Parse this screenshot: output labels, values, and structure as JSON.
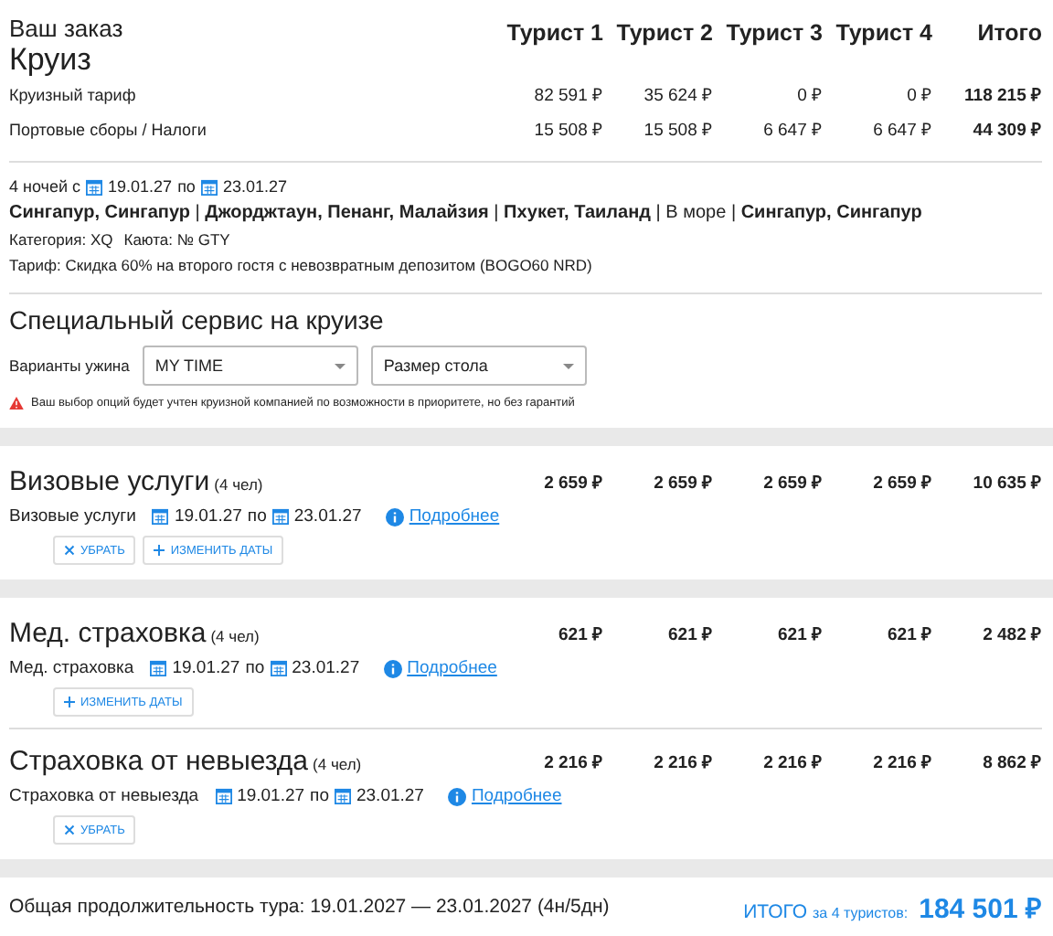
{
  "order": {
    "title": "Ваш заказ",
    "subtitle": "Круиз",
    "columns": [
      "Турист 1",
      "Турист 2",
      "Турист 3",
      "Турист 4",
      "Итого"
    ],
    "rows": [
      {
        "label": "Круизный тариф",
        "values": [
          "82 591 ₽",
          "35 624 ₽",
          "0 ₽",
          "0 ₽",
          "118 215 ₽"
        ]
      },
      {
        "label": "Портовые сборы / Налоги",
        "values": [
          "15 508 ₽",
          "15 508 ₽",
          "6 647 ₽",
          "6 647 ₽",
          "44 309 ₽"
        ]
      }
    ]
  },
  "cruise": {
    "nights": "4 ночей с",
    "from": "19.01.27",
    "by": "по",
    "to": "23.01.27",
    "route": "**Сингапур, Сингапур** | **Джорджтаун, Пенанг, Малайзия** | **Пхукет, Таиланд** | В море | **Сингапур, Сингапур**",
    "category": "Категория: XQ",
    "cabin": "Каюта: № GTY",
    "tariff": "Тариф: Скидка 60% на второго гостя с невозвратным депозитом (BOGO60 NRD)"
  },
  "special": {
    "title": "Специальный сервис на круизе",
    "label": "Варианты ужина",
    "selects": [
      {
        "value": "MY TIME"
      },
      {
        "placeholder": "Размер стола"
      }
    ],
    "warning": "Ваш выбор опций будет учтен круизной компанией по возможности в приоритете, но без гарантий"
  },
  "service_groups": [
    [
      {
        "title": "Визовые услуги",
        "persons": "(4 чел)",
        "prices": [
          "2 659 ₽",
          "2 659 ₽",
          "2 659 ₽",
          "2 659 ₽",
          "10 635 ₽"
        ],
        "name": "Визовые услуги",
        "from": "19.01.27",
        "by": "по",
        "to": "23.01.27",
        "link": "Подробнее",
        "buttons": [
          {
            "kind": "remove",
            "label": "УБРАТЬ"
          },
          {
            "kind": "dates",
            "label": "ИЗМЕНИТЬ ДАТЫ"
          }
        ]
      }
    ],
    [
      {
        "title": "Мед. страховка",
        "persons": "(4 чел)",
        "prices": [
          "621 ₽",
          "621 ₽",
          "621 ₽",
          "621 ₽",
          "2 482 ₽"
        ],
        "name": "Мед. страховка",
        "from": "19.01.27",
        "by": "по",
        "to": "23.01.27",
        "link": "Подробнее",
        "buttons": [
          {
            "kind": "dates",
            "label": "ИЗМЕНИТЬ ДАТЫ"
          }
        ]
      },
      {
        "title": "Страховка от невыезда",
        "persons": "(4 чел)",
        "prices": [
          "2 216 ₽",
          "2 216 ₽",
          "2 216 ₽",
          "2 216 ₽",
          "8 862 ₽"
        ],
        "name": "Страховка от невыезда",
        "from": "19.01.27",
        "by": "по",
        "to": "23.01.27",
        "link": "Подробнее",
        "buttons": [
          {
            "kind": "remove",
            "label": "УБРАТЬ"
          }
        ]
      }
    ]
  ],
  "footer": {
    "duration": "Общая продолжительность тура: 19.01.2027 — 23.01.2027 (4н/5дн)",
    "total_label": "ИТОГО",
    "total_for": "за 4 туристов:",
    "total": "184 501 ₽"
  }
}
